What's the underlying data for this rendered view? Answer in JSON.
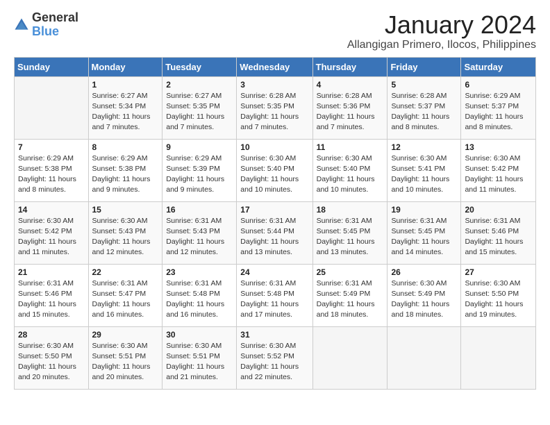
{
  "logo": {
    "general": "General",
    "blue": "Blue"
  },
  "title": "January 2024",
  "subtitle": "Allangigan Primero, Ilocos, Philippines",
  "headers": [
    "Sunday",
    "Monday",
    "Tuesday",
    "Wednesday",
    "Thursday",
    "Friday",
    "Saturday"
  ],
  "weeks": [
    [
      {
        "day": "",
        "sunrise": "",
        "sunset": "",
        "daylight": ""
      },
      {
        "day": "1",
        "sunrise": "Sunrise: 6:27 AM",
        "sunset": "Sunset: 5:34 PM",
        "daylight": "Daylight: 11 hours and 7 minutes."
      },
      {
        "day": "2",
        "sunrise": "Sunrise: 6:27 AM",
        "sunset": "Sunset: 5:35 PM",
        "daylight": "Daylight: 11 hours and 7 minutes."
      },
      {
        "day": "3",
        "sunrise": "Sunrise: 6:28 AM",
        "sunset": "Sunset: 5:35 PM",
        "daylight": "Daylight: 11 hours and 7 minutes."
      },
      {
        "day": "4",
        "sunrise": "Sunrise: 6:28 AM",
        "sunset": "Sunset: 5:36 PM",
        "daylight": "Daylight: 11 hours and 7 minutes."
      },
      {
        "day": "5",
        "sunrise": "Sunrise: 6:28 AM",
        "sunset": "Sunset: 5:37 PM",
        "daylight": "Daylight: 11 hours and 8 minutes."
      },
      {
        "day": "6",
        "sunrise": "Sunrise: 6:29 AM",
        "sunset": "Sunset: 5:37 PM",
        "daylight": "Daylight: 11 hours and 8 minutes."
      }
    ],
    [
      {
        "day": "7",
        "sunrise": "Sunrise: 6:29 AM",
        "sunset": "Sunset: 5:38 PM",
        "daylight": "Daylight: 11 hours and 8 minutes."
      },
      {
        "day": "8",
        "sunrise": "Sunrise: 6:29 AM",
        "sunset": "Sunset: 5:38 PM",
        "daylight": "Daylight: 11 hours and 9 minutes."
      },
      {
        "day": "9",
        "sunrise": "Sunrise: 6:29 AM",
        "sunset": "Sunset: 5:39 PM",
        "daylight": "Daylight: 11 hours and 9 minutes."
      },
      {
        "day": "10",
        "sunrise": "Sunrise: 6:30 AM",
        "sunset": "Sunset: 5:40 PM",
        "daylight": "Daylight: 11 hours and 10 minutes."
      },
      {
        "day": "11",
        "sunrise": "Sunrise: 6:30 AM",
        "sunset": "Sunset: 5:40 PM",
        "daylight": "Daylight: 11 hours and 10 minutes."
      },
      {
        "day": "12",
        "sunrise": "Sunrise: 6:30 AM",
        "sunset": "Sunset: 5:41 PM",
        "daylight": "Daylight: 11 hours and 10 minutes."
      },
      {
        "day": "13",
        "sunrise": "Sunrise: 6:30 AM",
        "sunset": "Sunset: 5:42 PM",
        "daylight": "Daylight: 11 hours and 11 minutes."
      }
    ],
    [
      {
        "day": "14",
        "sunrise": "Sunrise: 6:30 AM",
        "sunset": "Sunset: 5:42 PM",
        "daylight": "Daylight: 11 hours and 11 minutes."
      },
      {
        "day": "15",
        "sunrise": "Sunrise: 6:30 AM",
        "sunset": "Sunset: 5:43 PM",
        "daylight": "Daylight: 11 hours and 12 minutes."
      },
      {
        "day": "16",
        "sunrise": "Sunrise: 6:31 AM",
        "sunset": "Sunset: 5:43 PM",
        "daylight": "Daylight: 11 hours and 12 minutes."
      },
      {
        "day": "17",
        "sunrise": "Sunrise: 6:31 AM",
        "sunset": "Sunset: 5:44 PM",
        "daylight": "Daylight: 11 hours and 13 minutes."
      },
      {
        "day": "18",
        "sunrise": "Sunrise: 6:31 AM",
        "sunset": "Sunset: 5:45 PM",
        "daylight": "Daylight: 11 hours and 13 minutes."
      },
      {
        "day": "19",
        "sunrise": "Sunrise: 6:31 AM",
        "sunset": "Sunset: 5:45 PM",
        "daylight": "Daylight: 11 hours and 14 minutes."
      },
      {
        "day": "20",
        "sunrise": "Sunrise: 6:31 AM",
        "sunset": "Sunset: 5:46 PM",
        "daylight": "Daylight: 11 hours and 15 minutes."
      }
    ],
    [
      {
        "day": "21",
        "sunrise": "Sunrise: 6:31 AM",
        "sunset": "Sunset: 5:46 PM",
        "daylight": "Daylight: 11 hours and 15 minutes."
      },
      {
        "day": "22",
        "sunrise": "Sunrise: 6:31 AM",
        "sunset": "Sunset: 5:47 PM",
        "daylight": "Daylight: 11 hours and 16 minutes."
      },
      {
        "day": "23",
        "sunrise": "Sunrise: 6:31 AM",
        "sunset": "Sunset: 5:48 PM",
        "daylight": "Daylight: 11 hours and 16 minutes."
      },
      {
        "day": "24",
        "sunrise": "Sunrise: 6:31 AM",
        "sunset": "Sunset: 5:48 PM",
        "daylight": "Daylight: 11 hours and 17 minutes."
      },
      {
        "day": "25",
        "sunrise": "Sunrise: 6:31 AM",
        "sunset": "Sunset: 5:49 PM",
        "daylight": "Daylight: 11 hours and 18 minutes."
      },
      {
        "day": "26",
        "sunrise": "Sunrise: 6:30 AM",
        "sunset": "Sunset: 5:49 PM",
        "daylight": "Daylight: 11 hours and 18 minutes."
      },
      {
        "day": "27",
        "sunrise": "Sunrise: 6:30 AM",
        "sunset": "Sunset: 5:50 PM",
        "daylight": "Daylight: 11 hours and 19 minutes."
      }
    ],
    [
      {
        "day": "28",
        "sunrise": "Sunrise: 6:30 AM",
        "sunset": "Sunset: 5:50 PM",
        "daylight": "Daylight: 11 hours and 20 minutes."
      },
      {
        "day": "29",
        "sunrise": "Sunrise: 6:30 AM",
        "sunset": "Sunset: 5:51 PM",
        "daylight": "Daylight: 11 hours and 20 minutes."
      },
      {
        "day": "30",
        "sunrise": "Sunrise: 6:30 AM",
        "sunset": "Sunset: 5:51 PM",
        "daylight": "Daylight: 11 hours and 21 minutes."
      },
      {
        "day": "31",
        "sunrise": "Sunrise: 6:30 AM",
        "sunset": "Sunset: 5:52 PM",
        "daylight": "Daylight: 11 hours and 22 minutes."
      },
      {
        "day": "",
        "sunrise": "",
        "sunset": "",
        "daylight": ""
      },
      {
        "day": "",
        "sunrise": "",
        "sunset": "",
        "daylight": ""
      },
      {
        "day": "",
        "sunrise": "",
        "sunset": "",
        "daylight": ""
      }
    ]
  ]
}
